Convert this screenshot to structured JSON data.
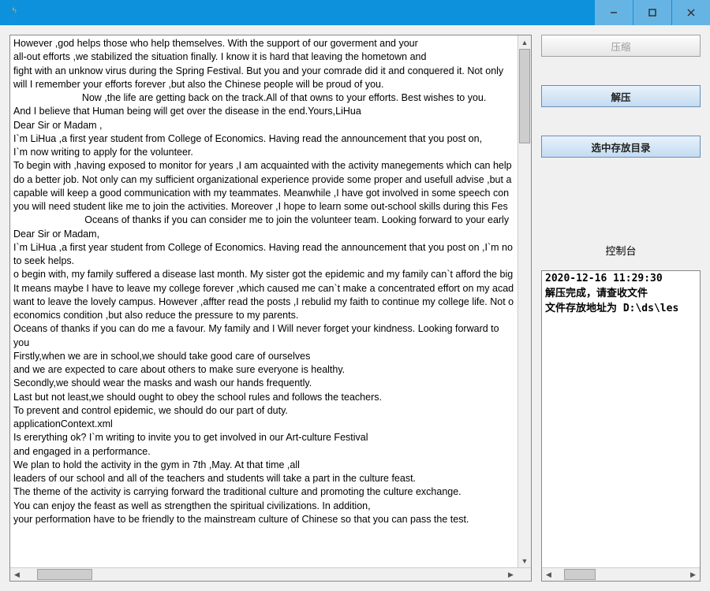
{
  "titlebar": {
    "title": ""
  },
  "buttons": {
    "compress": "压缩",
    "decompress": "解压",
    "select_dir": "选中存放目录"
  },
  "console": {
    "label": "控制台",
    "line1": "2020-12-16 11:29:30",
    "line2": "解压完成，请查收文件",
    "line3": "文件存放地址为 D:\\ds\\les"
  },
  "main_text": "However ,god helps those who help themselves. With the support of our goverment and your\nall-out efforts ,we stabilized the situation finally. I know it is hard that leaving the hometown and\nfight with an unknow virus during the Spring Festival. But you and your comrade did it and conquered it. Not only\nwill I remember your efforts forever ,but also the Chinese people will be proud of you.\n                         Now ,the life are getting back on the track.All of that owns to your efforts. Best wishes to you.\nAnd I believe that Human being will get over the disease in the end.Yours,LiHua\nDear Sir or Madam ,\nI`m LiHua ,a first year student from College of Economics. Having read the announcement that you post on,\nI`m now writing to apply for the volunteer.\nTo begin with ,having exposed to monitor for years ,I am acquainted with the activity manegements which can help\ndo a better job. Not only can my sufficient organizational experience provide some proper and usefull advise ,but a\ncapable will keep a good communication with my teammates. Meanwhile ,I have got involved in some speech con\nyou will need student like me to join the activities. Moreover ,I hope to learn some out-school skills during this Fes\n                          Oceans of thanks if you can consider me to join the volunteer team. Looking forward to your early\nDear Sir or Madam,\nI`m LiHua ,a first year student from College of Economics. Having read the announcement that you post on ,I`m no\nto seek helps.\no begin with, my family suffered a disease last month. My sister got the epidemic and my family can`t afford the big\nIt means maybe I have to leave my college forever ,which caused me can`t make a concentrated effort on my acad\nwant to leave the lovely campus. However ,affter read the posts ,I rebulid my faith to continue my college life. Not o\neconomics condition ,but also reduce the pressure to my parents.\nOceans of thanks if you can do me a favour. My family and I Will never forget your kindness. Looking forward to you\nFirstly,when we are in school,we should take good care of ourselves\nand we are expected to care about others to make sure everyone is healthy.\nSecondly,we should wear the masks and wash our hands frequently.\nLast but not least,we should ought to obey the school rules and follows the teachers.\nTo prevent and control epidemic, we should do our part of duty.\napplicationContext.xml\nIs ererything ok? I`m writing to invite you to get involved in our Art-culture Festival\nand engaged in a performance.\nWe plan to hold the activity in the gym in 7th ,May. At that time ,all\nleaders of our school and all of the teachers and students will take a part in the culture feast.\nThe theme of the activity is carrying forward the traditional culture and promoting the culture exchange.\nYou can enjoy the feast as well as strengthen the spiritual civilizations. In addition,\nyour performation have to be friendly to the mainstream culture of Chinese so that you can pass the test."
}
